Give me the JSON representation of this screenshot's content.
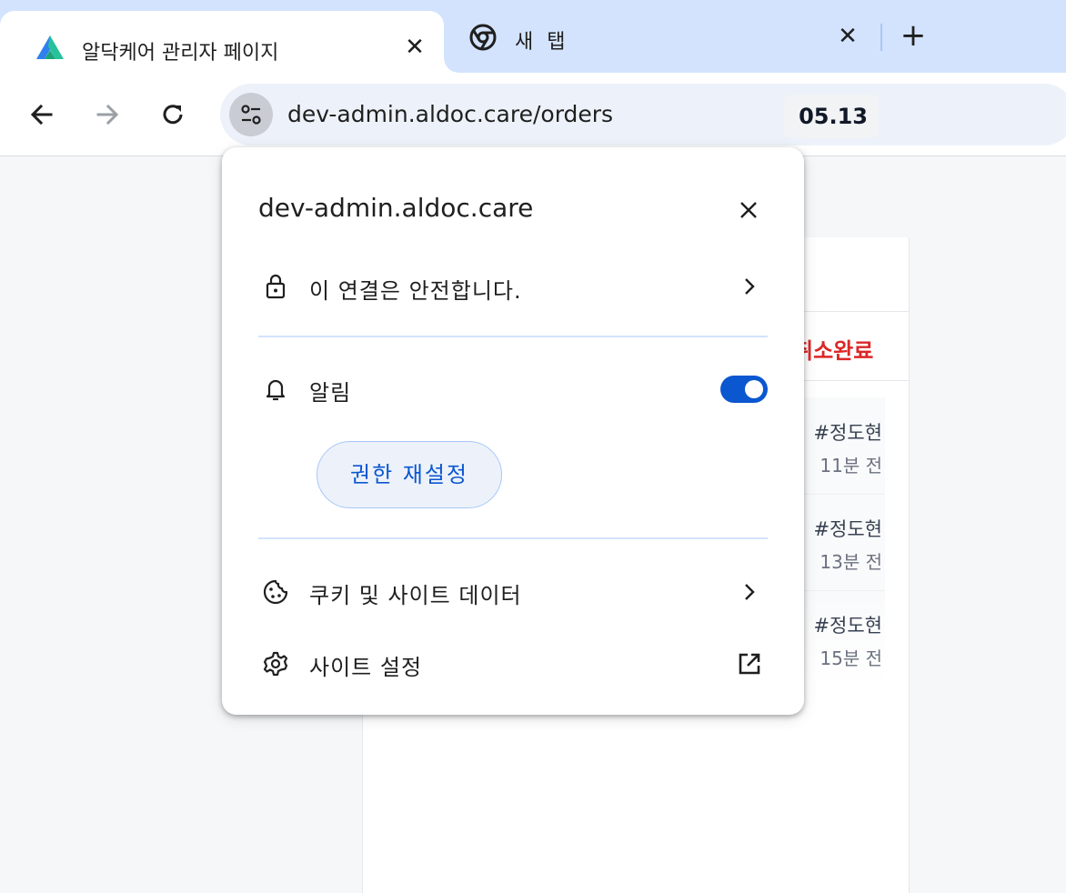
{
  "tabs": [
    {
      "title": "알닥케어 관리자 페이지",
      "active": true,
      "favicon": "aldoc-logo-icon"
    },
    {
      "title": "새 탭",
      "active": false,
      "favicon": "chrome-icon"
    }
  ],
  "toolbar": {
    "url": "dev-admin.aldoc.care/orders"
  },
  "popup": {
    "host": "dev-admin.aldoc.care",
    "connection_label": "이 연결은 안전합니다.",
    "notifications_label": "알림",
    "notifications_enabled": true,
    "reset_permissions_label": "권한 재설정",
    "cookies_label": "쿠키 및 사이트 데이터",
    "site_settings_label": "사이트 설정"
  },
  "page": {
    "date_partial": "05.13",
    "status_partial": "취소완료",
    "rows": [
      {
        "name": "#정도현",
        "time": "11분 전"
      },
      {
        "name": "#정도현",
        "time": "13분 전"
      },
      {
        "name": "#정도현",
        "time": "15분 전"
      }
    ]
  },
  "colors": {
    "accent": "#0b57d0",
    "tabstrip": "#d3e3fd",
    "status_red": "#dc2626"
  }
}
